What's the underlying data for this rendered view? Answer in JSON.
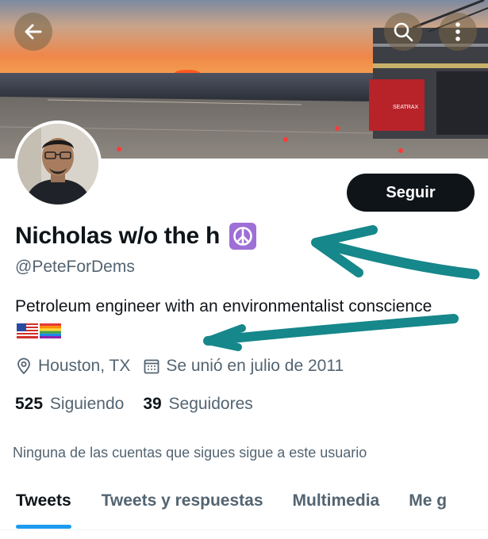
{
  "header": {
    "back_icon": "arrow-left-icon",
    "search_icon": "search-icon",
    "more_icon": "more-vertical-icon",
    "banner_image": "sunset over sea with offshore platform"
  },
  "profile": {
    "display_name": "Nicholas w/o the h",
    "name_emoji": "peace-symbol-icon",
    "handle": "@PeteForDems",
    "bio": "Petroleum engineer with an environmentalist conscience",
    "bio_emojis": [
      "us-flag-icon",
      "rainbow-flag-icon"
    ],
    "location": "Houston, TX",
    "joined": "Se unió en julio de 2011",
    "following_count": "525",
    "following_label": "Siguiendo",
    "followers_count": "39",
    "followers_label": "Seguidores",
    "follow_button_label": "Seguir",
    "followers_you_know": "Ninguna de las cuentas que sigues sigue a este usuario"
  },
  "tabs": [
    {
      "label": "Tweets",
      "active": true
    },
    {
      "label": "Tweets y respuestas",
      "active": false
    },
    {
      "label": "Multimedia",
      "active": false
    },
    {
      "label": "Me g",
      "active": false
    }
  ],
  "colors": {
    "accent": "#1d9bf0",
    "annotation_arrow": "#16878a",
    "button_bg": "#0f1419",
    "secondary_text": "#536471"
  }
}
